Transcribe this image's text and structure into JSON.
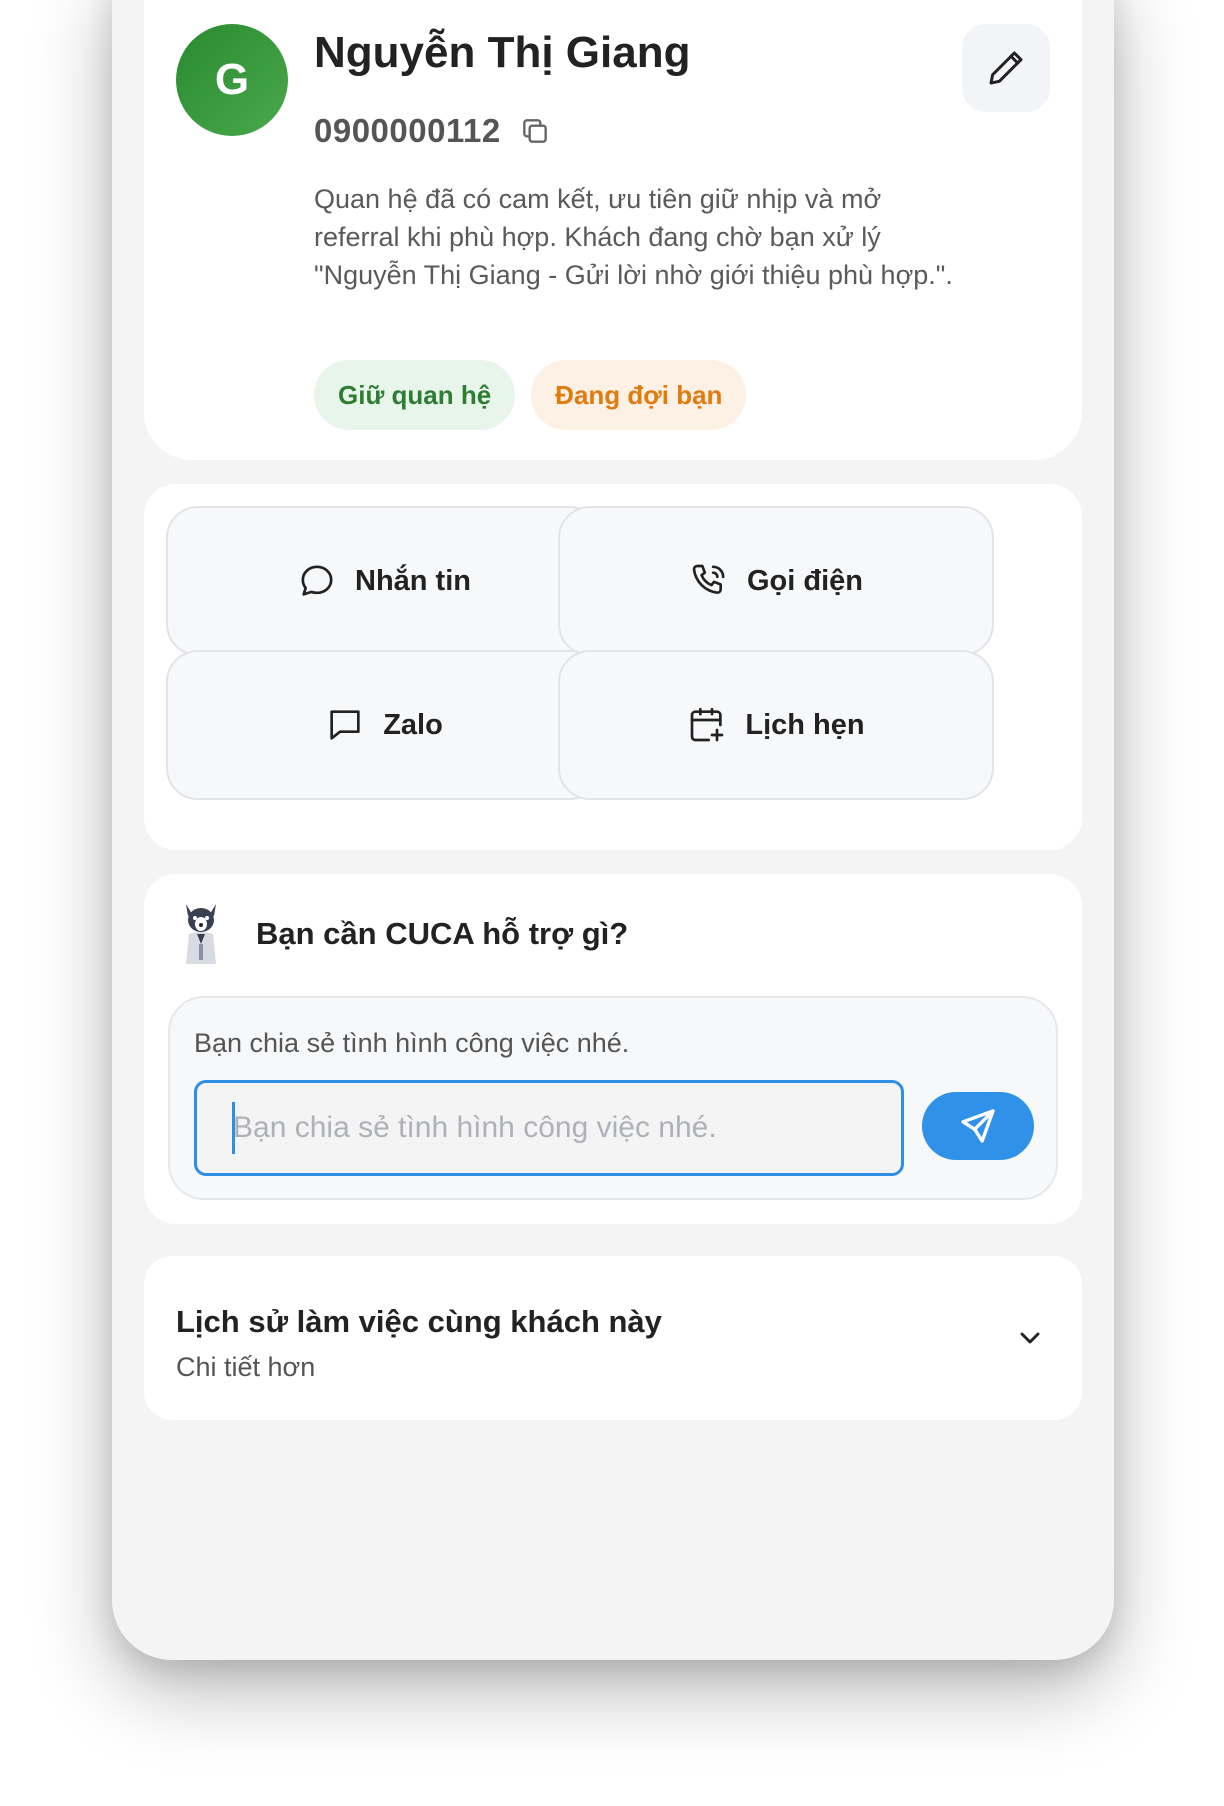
{
  "profile": {
    "avatar_letter": "G",
    "name": "Nguyễn Thị Giang",
    "phone": "0900000112",
    "description": "Quan hệ đã có cam kết, ưu tiên giữ nhịp và mở referral khi phù hợp. Khách đang chờ bạn xử lý \"Nguyễn Thị Giang - Gửi lời nhờ giới thiệu phù hợp.\".",
    "tags": [
      {
        "label": "Giữ quan hệ",
        "color": "#2e7d32"
      },
      {
        "label": "Đang đợi bạn",
        "color": "#e07b0e"
      }
    ]
  },
  "actions": {
    "message": "Nhắn tin",
    "call": "Gọi điện",
    "zalo": "Zalo",
    "schedule": "Lịch hẹn"
  },
  "assistant": {
    "title": "Bạn cần CUCA hỗ trợ gì?",
    "hint": "Bạn chia sẻ tình hình công việc nhé.",
    "input_placeholder": "Bạn chia sẻ tình hình công việc nhé.",
    "accent_color": "#2f92e8"
  },
  "history": {
    "title": "Lịch sử làm việc cùng khách này",
    "subtitle": "Chi tiết hơn"
  }
}
